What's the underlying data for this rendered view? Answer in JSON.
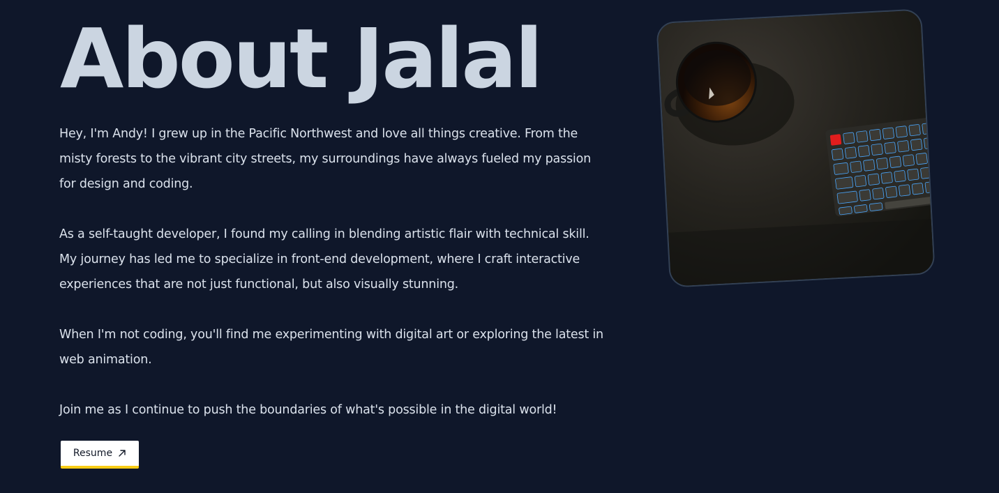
{
  "about": {
    "title": "About Jalal",
    "paragraphs": [
      "Hey, I'm Andy! I grew up in the Pacific Northwest and love all things creative. From the misty forests to the vibrant city streets, my surroundings have always fueled my passion for design and coding.",
      "As a self-taught developer, I found my calling in blending artistic flair with technical skill. My journey has led me to specialize in front-end development, where I craft interactive experiences that are not just functional, but also visually stunning.",
      "When I'm not coding, you'll find me experimenting with digital art or exploring the latest in web animation.",
      "Join me as I continue to push the boundaries of what's possible in the digital world!"
    ],
    "resume_label": "Resume",
    "resume_icon": "arrow-up-right-icon"
  },
  "photo": {
    "icon": "desk-photo"
  },
  "colors": {
    "background": "#0f172a",
    "heading": "#cbd5e1",
    "text": "#dbe2ec",
    "button_bg": "#ffffff",
    "button_accent": "#facc15",
    "frame_border": "#334155"
  }
}
